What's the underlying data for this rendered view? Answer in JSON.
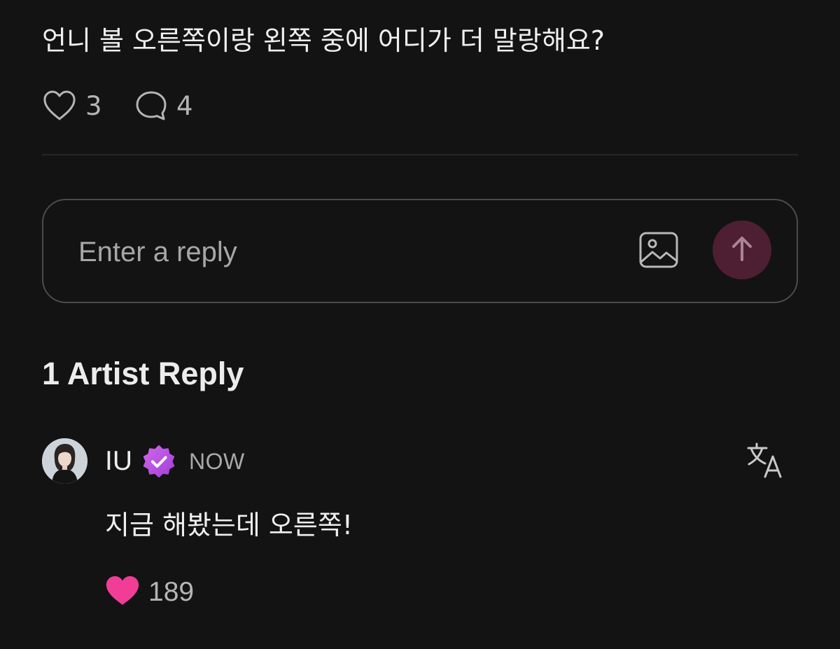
{
  "post": {
    "text": "언니 볼 오른쪽이랑 왼쪽 중에 어디가 더 말랑해요?",
    "like_count": "3",
    "comment_count": "4"
  },
  "composer": {
    "placeholder": "Enter a reply",
    "image_icon": "image-icon",
    "send_icon": "arrow-up-icon"
  },
  "artist_replies": {
    "title": "1 Artist Reply",
    "reply": {
      "author": "IU",
      "badge_icon": "verified-badge-icon",
      "timestamp": "NOW",
      "text": "지금 해봤는데 오른쪽!",
      "like_count": "189",
      "translate_icon": "translate-icon"
    }
  },
  "colors": {
    "background": "#131313",
    "send_button": "#4e1f33",
    "badge": "#b84ee0",
    "heart_filled": "#f23d97"
  }
}
